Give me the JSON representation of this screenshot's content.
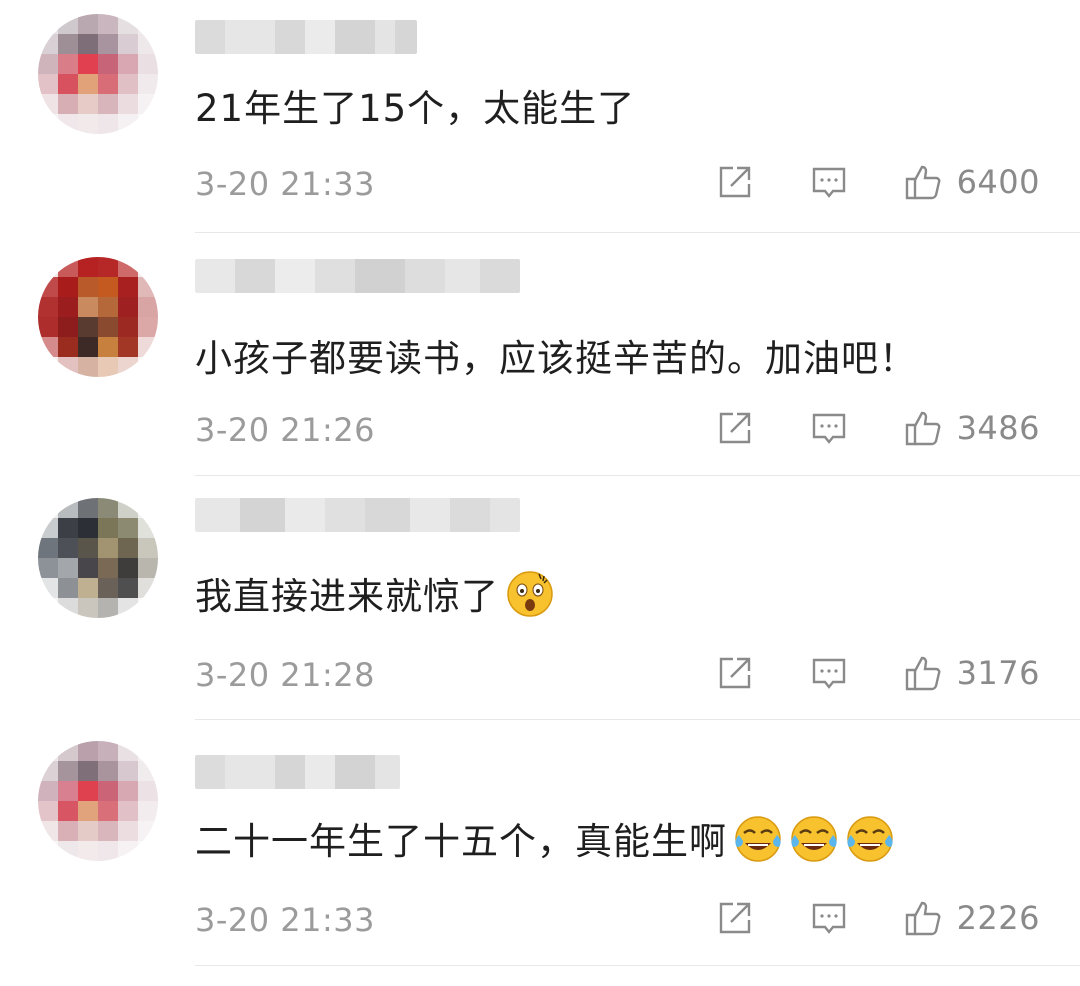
{
  "comments": [
    {
      "text": "21年生了15个，太能生了",
      "time": "3-20 21:33",
      "likes": "6400",
      "emoji": []
    },
    {
      "text": "小孩子都要读书，应该挺辛苦的。加油吧！",
      "time": "3-20 21:26",
      "likes": "3486",
      "emoji": []
    },
    {
      "text": "我直接进来就惊了",
      "time": "3-20 21:28",
      "likes": "3176",
      "emoji": [
        "shocked-emoji"
      ]
    },
    {
      "text": "二十一年生了十五个，真能生啊",
      "time": "3-20 21:33",
      "likes": "2226",
      "emoji": [
        "laugh-cry-emoji",
        "laugh-cry-emoji",
        "laugh-cry-emoji"
      ]
    }
  ],
  "icons": {
    "share": "share-icon",
    "reply": "comment-icon",
    "like": "thumbs-up-icon"
  },
  "colors": {
    "text": "#1f1f1f",
    "meta": "#9b9b9b",
    "icon": "#8a8a8a"
  }
}
